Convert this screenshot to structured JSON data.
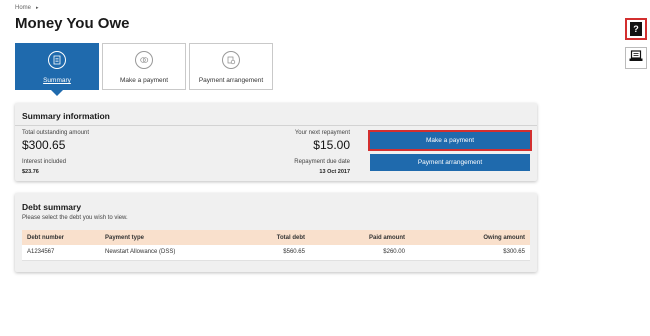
{
  "breadcrumb": {
    "home": "Home",
    "separator": "▸"
  },
  "page": {
    "title": "Money You Owe"
  },
  "tabs": [
    {
      "label": "Summary",
      "icon": "document-icon",
      "active": true
    },
    {
      "label": "Make a payment",
      "icon": "coins-icon",
      "active": false
    },
    {
      "label": "Payment arrangement",
      "icon": "calendar-coin-icon",
      "active": false
    }
  ],
  "summary": {
    "title": "Summary information",
    "total_label": "Total outstanding amount",
    "total_value": "$300.65",
    "interest_label": "Interest included",
    "interest_value": "$23.76",
    "next_label": "Your next repayment",
    "next_value": "$15.00",
    "due_label": "Repayment due date",
    "due_value": "13 Oct 2017",
    "make_payment": "Make a payment",
    "payment_arrangement": "Payment arrangement"
  },
  "debt": {
    "title": "Debt summary",
    "hint": "Please select the debt you wish to view.",
    "columns": [
      "Debt number",
      "Payment type",
      "Total debt",
      "Paid amount",
      "Owing amount"
    ],
    "rows": [
      [
        "A1234567",
        "Newstart Allowance (DSS)",
        "$560.65",
        "$260.00",
        "$300.65"
      ]
    ]
  },
  "side": {
    "help_glyph": "?",
    "print_icon": "laptop-print-icon"
  },
  "colors": {
    "primary": "#1f6aad",
    "highlight": "#d32f2f",
    "table_header": "#f9e0cc"
  }
}
